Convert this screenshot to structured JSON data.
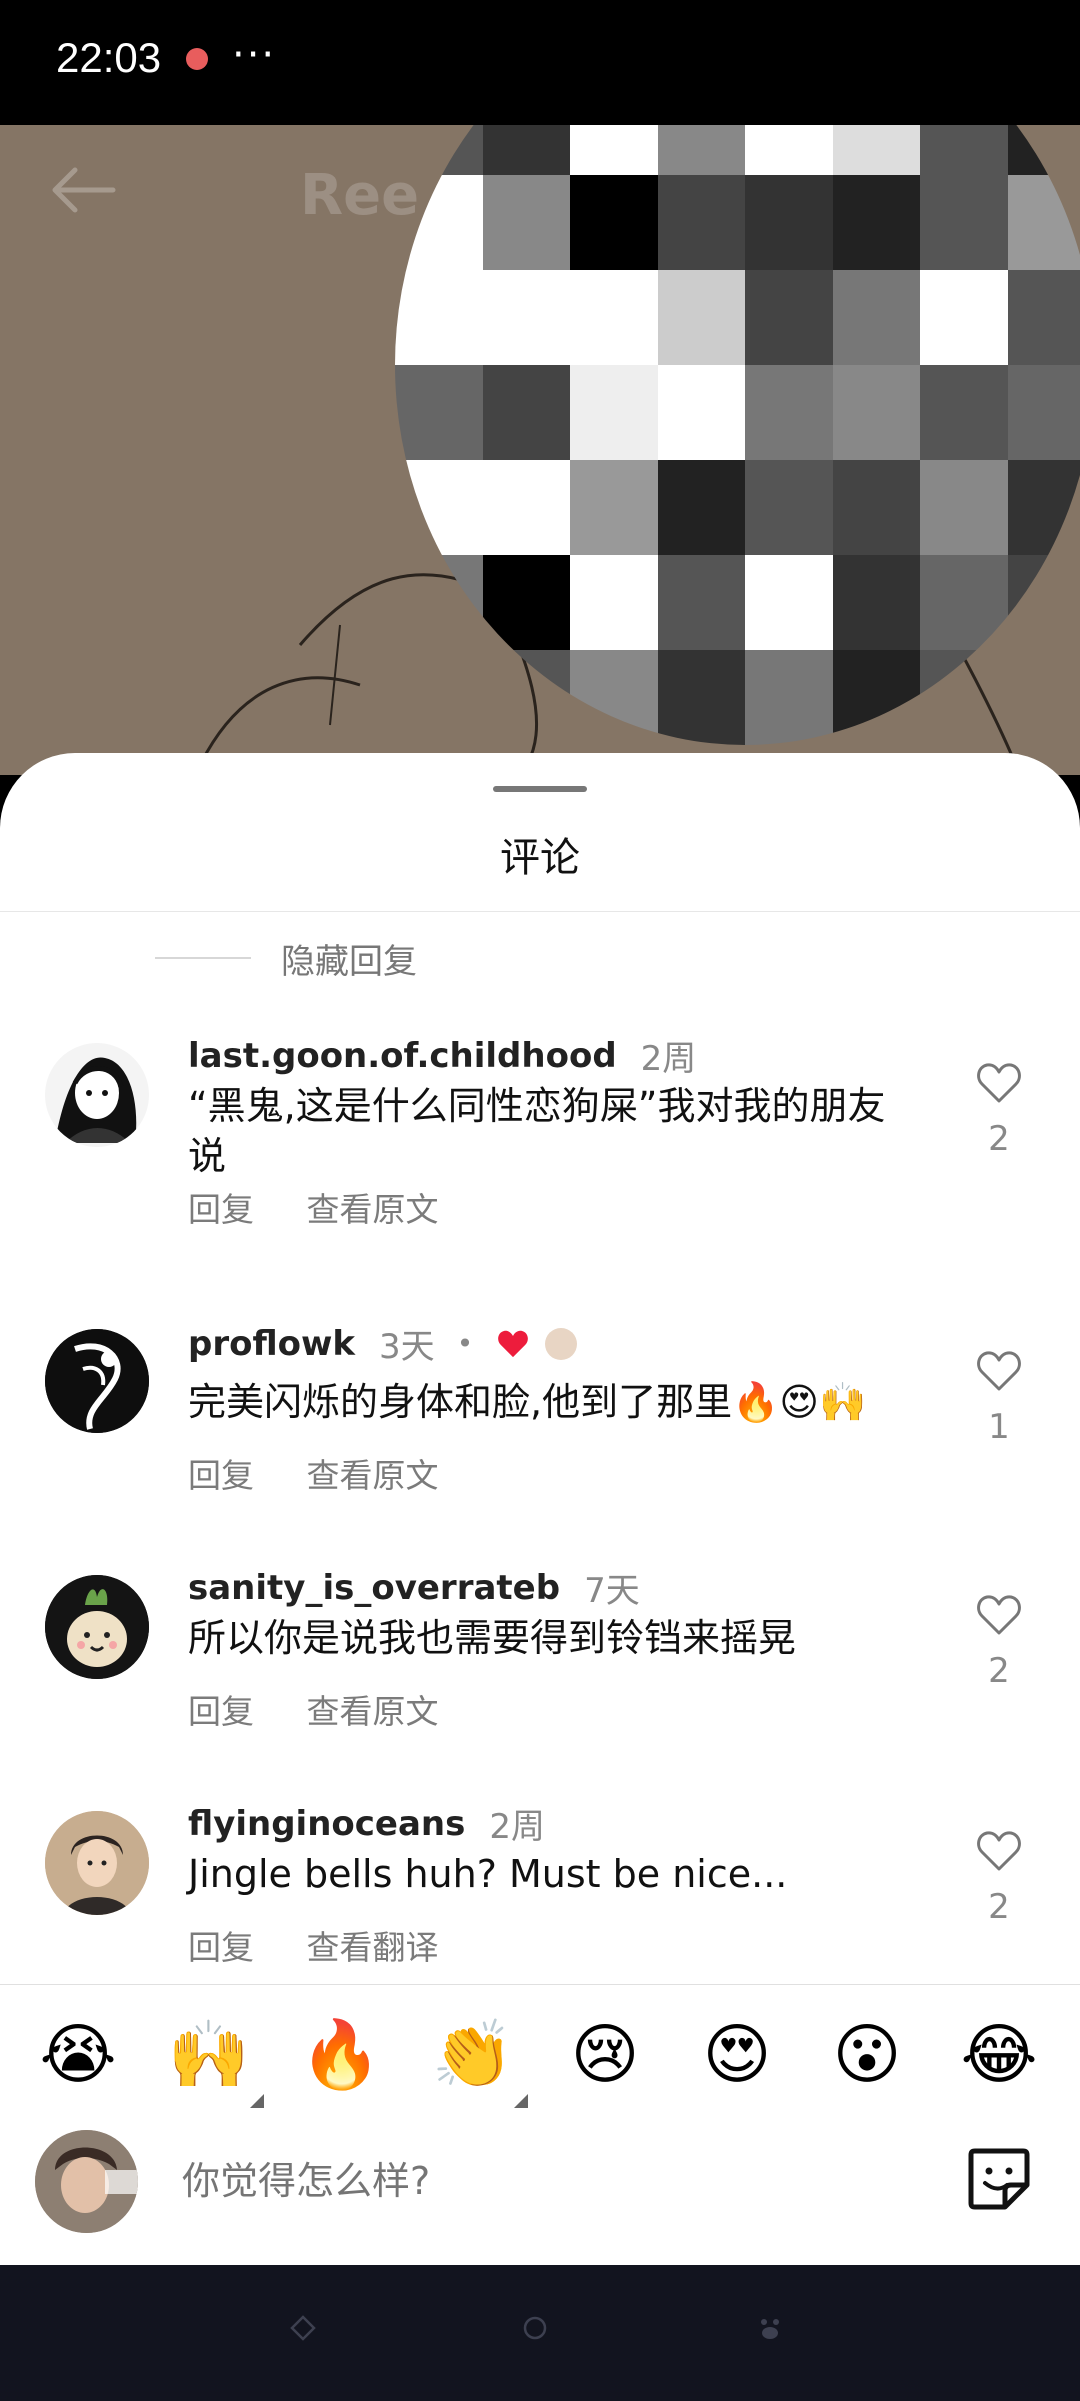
{
  "status_bar": {
    "time": "22:03",
    "more": "···"
  },
  "video": {
    "title": "Ree"
  },
  "sheet": {
    "title": "评论",
    "hide_replies": "隐藏回复"
  },
  "comments": [
    {
      "username": "last.goon.of.childhood",
      "age": "2周",
      "text": "“黑鬼,这是什么同性恋狗屎”我对我的朋友说",
      "reply": "回复",
      "translate": "查看原文",
      "likes": "2"
    },
    {
      "username": "proflowk",
      "age": "3天",
      "separator": "•",
      "text": "完美闪烁的身体和脸,他到了那里🔥😍🙌",
      "reply": "回复",
      "translate": "查看原文",
      "likes": "1"
    },
    {
      "username": "sanity_is_overrateb",
      "age": "7天",
      "text": "所以你是说我也需要得到铃铛来摇晃",
      "reply": "回复",
      "translate": "查看原文",
      "likes": "2"
    },
    {
      "username": "flyinginoceans",
      "age": "2周",
      "text": "Jingle bells huh? Must be nice...",
      "reply": "回复",
      "translate": "查看翻译",
      "likes": "2"
    }
  ],
  "emoji_tray": [
    "😭",
    "🙌",
    "🔥",
    "👏",
    "😢",
    "😍",
    "😮",
    "😂"
  ],
  "composer": {
    "placeholder": "你觉得怎么样?"
  },
  "colors": {
    "like_heart": "#ed1c3c",
    "sheet_bg": "#ffffff",
    "navbar_bg": "#12141f"
  }
}
